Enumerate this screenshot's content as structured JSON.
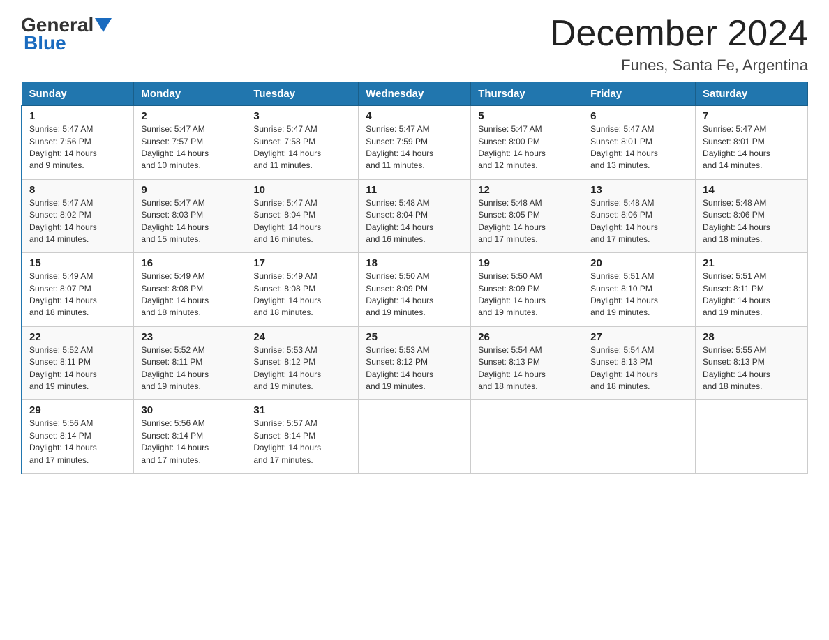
{
  "header": {
    "logo_general": "General",
    "logo_blue": "Blue",
    "month_title": "December 2024",
    "location": "Funes, Santa Fe, Argentina"
  },
  "days_of_week": [
    "Sunday",
    "Monday",
    "Tuesday",
    "Wednesday",
    "Thursday",
    "Friday",
    "Saturday"
  ],
  "weeks": [
    [
      {
        "num": "1",
        "sunrise": "5:47 AM",
        "sunset": "7:56 PM",
        "daylight": "14 hours and 9 minutes."
      },
      {
        "num": "2",
        "sunrise": "5:47 AM",
        "sunset": "7:57 PM",
        "daylight": "14 hours and 10 minutes."
      },
      {
        "num": "3",
        "sunrise": "5:47 AM",
        "sunset": "7:58 PM",
        "daylight": "14 hours and 11 minutes."
      },
      {
        "num": "4",
        "sunrise": "5:47 AM",
        "sunset": "7:59 PM",
        "daylight": "14 hours and 11 minutes."
      },
      {
        "num": "5",
        "sunrise": "5:47 AM",
        "sunset": "8:00 PM",
        "daylight": "14 hours and 12 minutes."
      },
      {
        "num": "6",
        "sunrise": "5:47 AM",
        "sunset": "8:01 PM",
        "daylight": "14 hours and 13 minutes."
      },
      {
        "num": "7",
        "sunrise": "5:47 AM",
        "sunset": "8:01 PM",
        "daylight": "14 hours and 14 minutes."
      }
    ],
    [
      {
        "num": "8",
        "sunrise": "5:47 AM",
        "sunset": "8:02 PM",
        "daylight": "14 hours and 14 minutes."
      },
      {
        "num": "9",
        "sunrise": "5:47 AM",
        "sunset": "8:03 PM",
        "daylight": "14 hours and 15 minutes."
      },
      {
        "num": "10",
        "sunrise": "5:47 AM",
        "sunset": "8:04 PM",
        "daylight": "14 hours and 16 minutes."
      },
      {
        "num": "11",
        "sunrise": "5:48 AM",
        "sunset": "8:04 PM",
        "daylight": "14 hours and 16 minutes."
      },
      {
        "num": "12",
        "sunrise": "5:48 AM",
        "sunset": "8:05 PM",
        "daylight": "14 hours and 17 minutes."
      },
      {
        "num": "13",
        "sunrise": "5:48 AM",
        "sunset": "8:06 PM",
        "daylight": "14 hours and 17 minutes."
      },
      {
        "num": "14",
        "sunrise": "5:48 AM",
        "sunset": "8:06 PM",
        "daylight": "14 hours and 18 minutes."
      }
    ],
    [
      {
        "num": "15",
        "sunrise": "5:49 AM",
        "sunset": "8:07 PM",
        "daylight": "14 hours and 18 minutes."
      },
      {
        "num": "16",
        "sunrise": "5:49 AM",
        "sunset": "8:08 PM",
        "daylight": "14 hours and 18 minutes."
      },
      {
        "num": "17",
        "sunrise": "5:49 AM",
        "sunset": "8:08 PM",
        "daylight": "14 hours and 18 minutes."
      },
      {
        "num": "18",
        "sunrise": "5:50 AM",
        "sunset": "8:09 PM",
        "daylight": "14 hours and 19 minutes."
      },
      {
        "num": "19",
        "sunrise": "5:50 AM",
        "sunset": "8:09 PM",
        "daylight": "14 hours and 19 minutes."
      },
      {
        "num": "20",
        "sunrise": "5:51 AM",
        "sunset": "8:10 PM",
        "daylight": "14 hours and 19 minutes."
      },
      {
        "num": "21",
        "sunrise": "5:51 AM",
        "sunset": "8:11 PM",
        "daylight": "14 hours and 19 minutes."
      }
    ],
    [
      {
        "num": "22",
        "sunrise": "5:52 AM",
        "sunset": "8:11 PM",
        "daylight": "14 hours and 19 minutes."
      },
      {
        "num": "23",
        "sunrise": "5:52 AM",
        "sunset": "8:11 PM",
        "daylight": "14 hours and 19 minutes."
      },
      {
        "num": "24",
        "sunrise": "5:53 AM",
        "sunset": "8:12 PM",
        "daylight": "14 hours and 19 minutes."
      },
      {
        "num": "25",
        "sunrise": "5:53 AM",
        "sunset": "8:12 PM",
        "daylight": "14 hours and 19 minutes."
      },
      {
        "num": "26",
        "sunrise": "5:54 AM",
        "sunset": "8:13 PM",
        "daylight": "14 hours and 18 minutes."
      },
      {
        "num": "27",
        "sunrise": "5:54 AM",
        "sunset": "8:13 PM",
        "daylight": "14 hours and 18 minutes."
      },
      {
        "num": "28",
        "sunrise": "5:55 AM",
        "sunset": "8:13 PM",
        "daylight": "14 hours and 18 minutes."
      }
    ],
    [
      {
        "num": "29",
        "sunrise": "5:56 AM",
        "sunset": "8:14 PM",
        "daylight": "14 hours and 17 minutes."
      },
      {
        "num": "30",
        "sunrise": "5:56 AM",
        "sunset": "8:14 PM",
        "daylight": "14 hours and 17 minutes."
      },
      {
        "num": "31",
        "sunrise": "5:57 AM",
        "sunset": "8:14 PM",
        "daylight": "14 hours and 17 minutes."
      },
      null,
      null,
      null,
      null
    ]
  ],
  "labels": {
    "sunrise": "Sunrise:",
    "sunset": "Sunset:",
    "daylight": "Daylight:"
  }
}
